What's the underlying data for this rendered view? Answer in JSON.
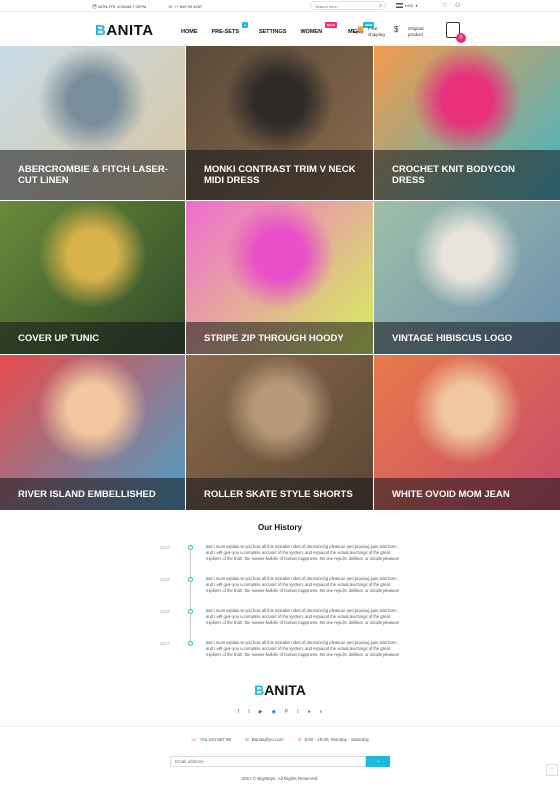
{
  "topbar": {
    "hours": "MON-FRI: 8:30AM-7:30PM",
    "phone": "+7 849 95 4287",
    "search_placeholder": "Search here...",
    "currency": "USD"
  },
  "header": {
    "logo_first": "B",
    "logo_rest": "ANITA",
    "nav": [
      {
        "label": "HOME",
        "badge": ""
      },
      {
        "label": "PRE-SETS",
        "badge": "●",
        "badge_color": "#1fbadb"
      },
      {
        "label": "SETTINGS",
        "badge": ""
      },
      {
        "label": "WOMEN",
        "badge": "SALE",
        "badge_color": "#e8307b"
      },
      {
        "label": "MEN",
        "badge": "NEW",
        "badge_color": "#1fbadb"
      }
    ],
    "free_shipping": [
      "Free",
      "shipping"
    ],
    "original_product": [
      "Original",
      "product"
    ],
    "cart_count": "0"
  },
  "products": [
    {
      "title": "ABERCROMBIE & FITCH LASER-CUT LINEN",
      "colors": [
        "#c8dbe8",
        "#7a8f9c",
        "#d9c6a0"
      ]
    },
    {
      "title": "MONKI CONTRAST TRIM V NECK MIDI DRESS",
      "colors": [
        "#5a4a3a",
        "#2e2a27",
        "#8a6b4c"
      ]
    },
    {
      "title": "CROCHET KNIT BODYCON DRESS",
      "colors": [
        "#f29a4a",
        "#e8307b",
        "#3fb6c8"
      ]
    },
    {
      "title": "COVER UP TUNIC",
      "colors": [
        "#6a8a3a",
        "#d8b24a",
        "#2f4a28"
      ]
    },
    {
      "title": "STRIPE ZIP THROUGH HOODY",
      "colors": [
        "#f06bd2",
        "#e84fc8",
        "#d6f25a"
      ]
    },
    {
      "title": "VINTAGE HIBISCUS LOGO",
      "colors": [
        "#9fbfa8",
        "#e8e4dc",
        "#6b8fb0"
      ]
    },
    {
      "title": "RIVER ISLAND EMBELLISHED",
      "colors": [
        "#e84a4a",
        "#f3c7a0",
        "#4aa0c8"
      ]
    },
    {
      "title": "ROLLER SKATE STYLE SHORTS",
      "colors": [
        "#8a6a4c",
        "#b89a7a",
        "#5b4634"
      ]
    },
    {
      "title": "WHITE OVOID MOM JEAN",
      "colors": [
        "#e87a4a",
        "#f0c8a0",
        "#c84a6a"
      ]
    }
  ],
  "history": {
    "title": "Our History",
    "items": [
      {
        "year": "2013",
        "text": "But I must explain to you how all this mistaken idea of denouncing pleasure and praising pain was born and I will give you a complete account of the system, and expound the actual teachings of the great explorer of the truth, the master-builder of human happiness. No one rejects, dislikes, or avoids pleasure"
      },
      {
        "year": "2015",
        "text": "But I must explain to you how all this mistaken idea of denouncing pleasure and praising pain was born and I will give you a complete account of the system, and expound the actual teachings of the great explorer of the truth, the master-builder of human happiness. No one rejects, dislikes, or avoids pleasure"
      },
      {
        "year": "2016",
        "text": "But I must explain to you how all this mistaken idea of denouncing pleasure and praising pain was born and I will give you a complete account of the system, and expound the actual teachings of the great explorer of the truth, the master-builder of human happiness. No one rejects, dislikes, or avoids pleasure"
      },
      {
        "year": "2017",
        "text": "But I must explain to you how all this mistaken idea of denouncing pleasure and praising pain was born and I will give you a complete account of the system, and expound the actual teachings of the great explorer of the truth, the master-builder of human happiness. No one rejects, dislikes, or avoids pleasure"
      }
    ]
  },
  "footer": {
    "logo_first": "B",
    "logo_rest": "ANITA",
    "social": [
      "f",
      "t",
      "▶",
      "◉",
      "P",
      "t",
      "●",
      "v"
    ],
    "phone": "+01 234 567 89",
    "email": "Banita@yo.com",
    "hours": "8:00 - 19:00, Monday - Saturday",
    "email_placeholder": "Email address",
    "submit": "→",
    "copyright": "2017 © BigSteps. All Rights Reserved."
  },
  "colors": {
    "accent": "#1fbadb",
    "pink": "#e8307b"
  }
}
